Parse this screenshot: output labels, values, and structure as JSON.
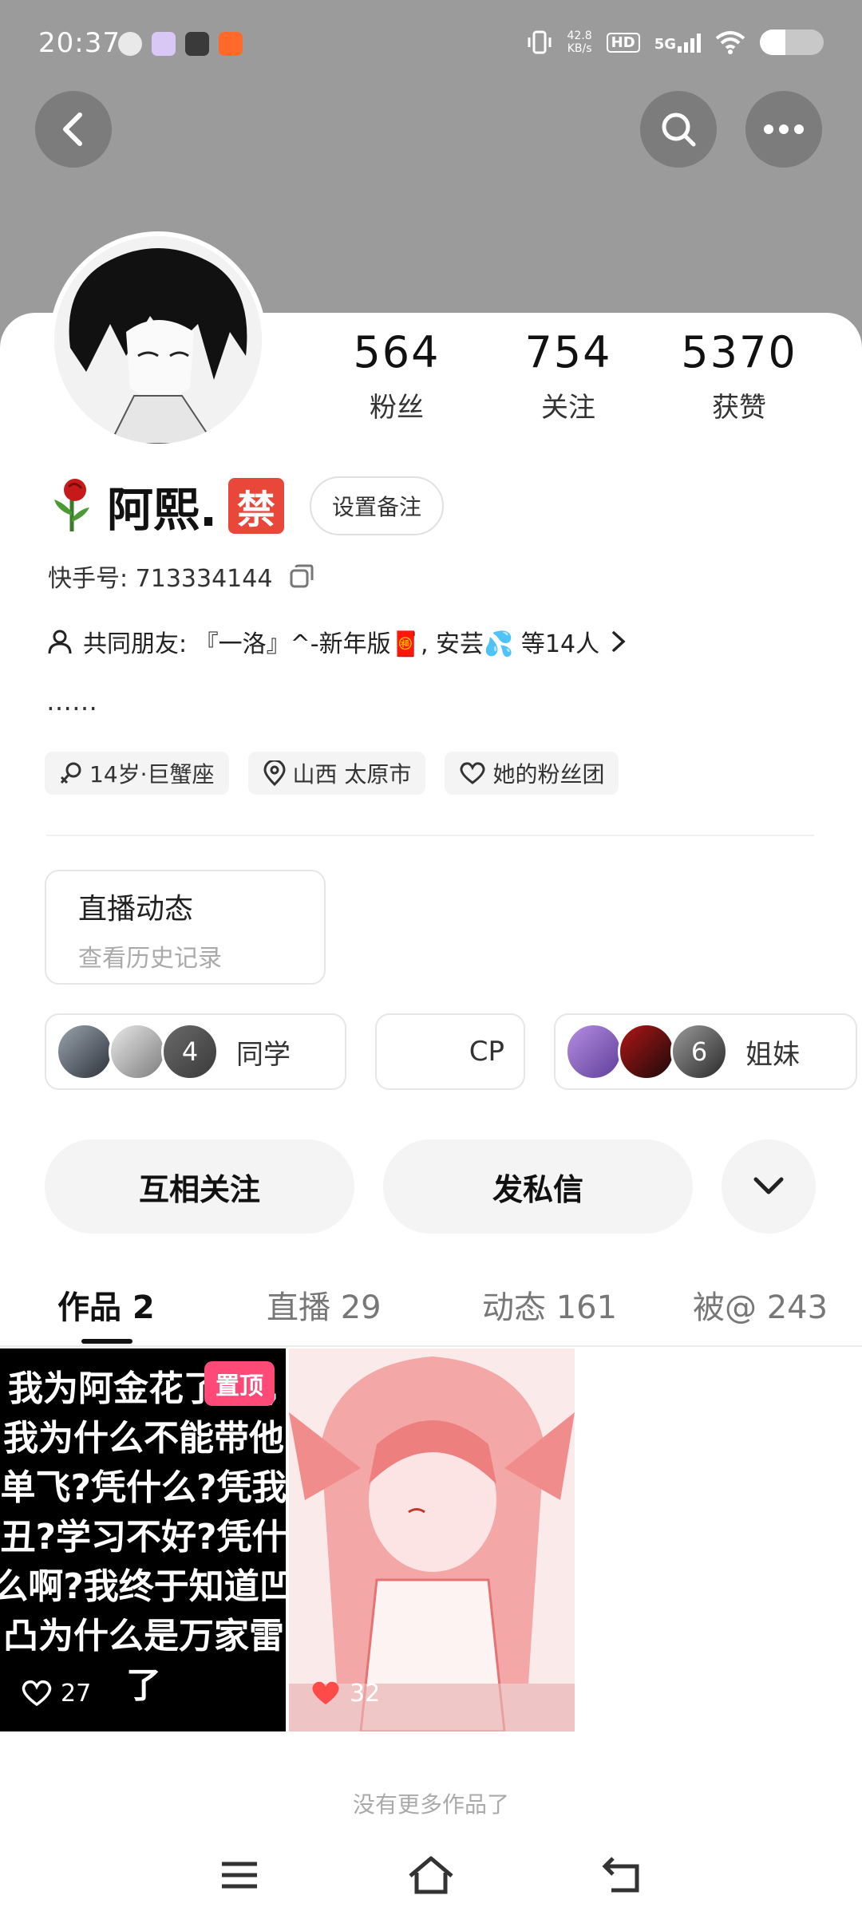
{
  "status_bar": {
    "time": "20:37",
    "net_speed_value": "42.8",
    "net_speed_unit": "KB/s",
    "hd_badge": "HD",
    "network_label": "5G",
    "battery_level": 0.4
  },
  "header": {
    "back_icon": "chevron-left-icon",
    "search_icon": "search-icon",
    "more_icon": "more-dots-icon"
  },
  "profile": {
    "stats": [
      {
        "value": "564",
        "label": "粉丝"
      },
      {
        "value": "754",
        "label": "关注"
      },
      {
        "value": "5370",
        "label": "获赞"
      }
    ],
    "name": "阿熙.",
    "name_badge": "禁",
    "remark_button": "设置备注",
    "kuaishou_id": "快手号: 713334144",
    "mutual_friends": "共同朋友: 『一洛』^-新年版🧧, 安芸💦 等14人",
    "bio": "……",
    "tags": [
      {
        "icon": "gender-female-icon",
        "text": "14岁·巨蟹座"
      },
      {
        "icon": "location-pin-icon",
        "text": "山西 太原市"
      },
      {
        "icon": "heart-icon",
        "text": "她的粉丝团"
      }
    ]
  },
  "live_card": {
    "title": "直播动态",
    "subtitle": "查看历史记录"
  },
  "groups": [
    {
      "count": "4",
      "label": "同学"
    },
    {
      "count": "",
      "label": "CP"
    },
    {
      "count": "6",
      "label": "姐妹"
    }
  ],
  "actions": {
    "mutual_follow": "互相关注",
    "message": "发私信",
    "expand_icon": "chevron-down-icon"
  },
  "tabs": [
    {
      "label": "作品 2",
      "active": true
    },
    {
      "label": "直播 29",
      "active": false
    },
    {
      "label": "动态 161",
      "active": false
    },
    {
      "label": "被@ 243",
      "active": false
    }
  ],
  "works": [
    {
      "text": "我为阿金花了 元,我为什么不能带他单飞?凭什么?凭我丑?学习不好?凭什么啊?我终于知道凹凸为什么是万家雷了",
      "pinned_label": "置顶",
      "likes": "27"
    },
    {
      "likes": "32"
    }
  ],
  "footer": {
    "no_more": "没有更多作品了"
  },
  "nav": {
    "menu_icon": "menu-icon",
    "home_icon": "home-icon",
    "back_icon": "back-arrow-icon"
  },
  "colors": {
    "header_bg": "#9b9b9b",
    "ban_badge": "#e8473a",
    "pin_badge": "#ff4a78",
    "like_heart": "#ff4a4a"
  }
}
